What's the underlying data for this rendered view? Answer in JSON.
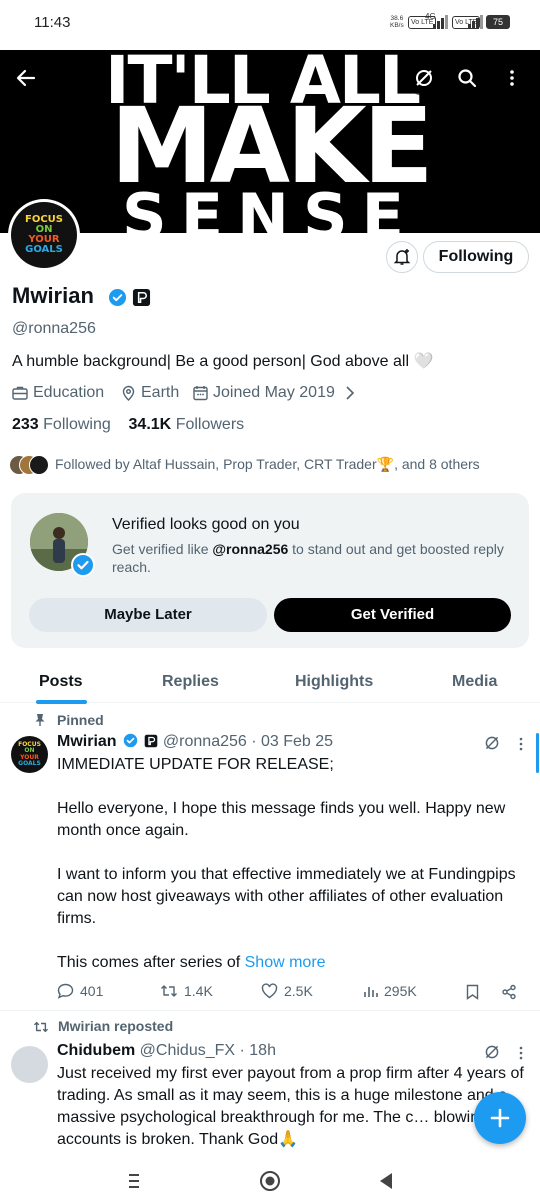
{
  "status_bar": {
    "time": "11:43",
    "speed_value": "38.6",
    "speed_unit": "KB/s",
    "chips": [
      "Vo LTE",
      "Vo LTE"
    ],
    "net_label": "4G",
    "battery": "75"
  },
  "banner": {
    "line1": "IT'LL ALL",
    "line2": "MAKE",
    "line3": "SENSE"
  },
  "header_icons": [
    "back-arrow-icon",
    "grok-icon",
    "search-icon",
    "more-vertical-icon"
  ],
  "avatar": {
    "lines": [
      "FOCUS",
      "ON",
      "YOUR",
      "GOALS"
    ],
    "colors": [
      "#f7d43b",
      "#7ac943",
      "#f15a24",
      "#29abe2"
    ]
  },
  "profile": {
    "name": "Mwirian",
    "handle": "@ronna256",
    "bio": "A humble background| Be a good person| God above all 🤍",
    "category": "Education",
    "location": "Earth",
    "joined": "Joined May 2019",
    "following_count": "233",
    "following_label": "Following",
    "followers_count": "34.1K",
    "followers_label": "Followers",
    "followed_by": "Followed by Altaf Hussain, Prop Trader, CRT Trader🏆, and 8 others",
    "following_button": "Following"
  },
  "verify_card": {
    "title": "Verified looks good on you",
    "sub_prefix": "Get verified like ",
    "sub_handle": "@ronna256",
    "sub_suffix": " to stand out and get boosted reply reach.",
    "later_button": "Maybe Later",
    "verify_button": "Get Verified"
  },
  "tabs": [
    {
      "label": "Posts",
      "active": true
    },
    {
      "label": "Replies",
      "active": false
    },
    {
      "label": "Highlights",
      "active": false
    },
    {
      "label": "Media",
      "active": false
    }
  ],
  "pinned_post": {
    "pinned_label": "Pinned",
    "name": "Mwirian",
    "meta": "@ronna256 · 03 Feb 25",
    "body": "IMMEDIATE UPDATE FOR RELEASE;\n\nHello everyone, I hope this message finds you well. Happy new month once again.\n\nI want to inform you that effective immediately we at Fundingpips can now host giveaways with other affiliates of other evaluation firms.\n\nThis comes after series of ",
    "show_more": "Show more",
    "replies": "401",
    "reposts": "1.4K",
    "likes": "2.5K",
    "views": "295K"
  },
  "repost": {
    "reposted_label": "Mwirian reposted",
    "name": "Chidubem",
    "meta": "@Chidus_FX · 18h",
    "body": "Just received my first ever payout from a prop firm after 4 years of trading. As small as it may seem, this is a huge milestone and a massive psychological breakthrough for me. The c… blowing Prop accounts is broken. Thank God🙏"
  },
  "colors": {
    "accent": "#1d9bf0",
    "text": "#0f1419",
    "muted": "#536471",
    "verified_gold": "#0f1419"
  }
}
